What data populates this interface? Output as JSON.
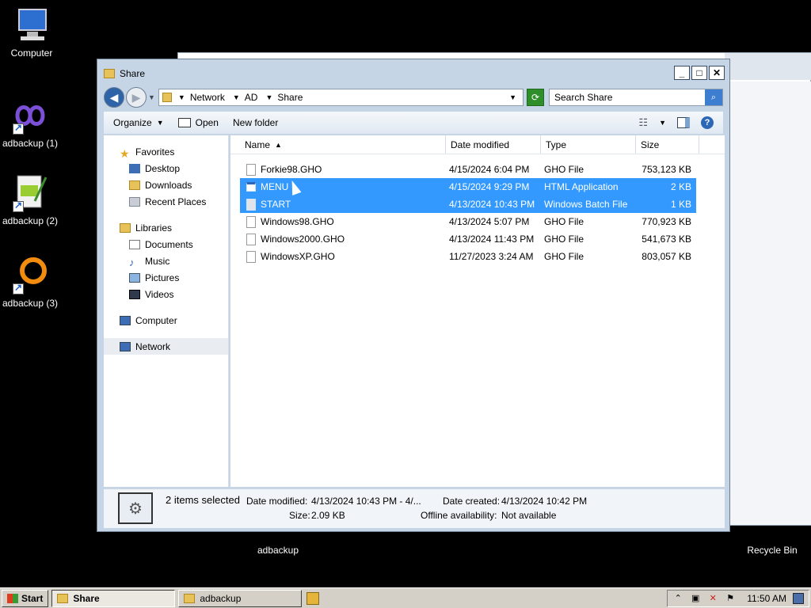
{
  "desktop": {
    "icons": [
      {
        "label": "Computer"
      },
      {
        "label": "adbackup (1)"
      },
      {
        "label": "adbackup (2)"
      },
      {
        "label": "adbackup (3)"
      },
      {
        "label": "adbackup"
      },
      {
        "label": "Recycle Bin"
      }
    ]
  },
  "window": {
    "title": "Share",
    "breadcrumb": [
      "Network",
      "AD",
      "Share"
    ],
    "search_placeholder": "Search Share",
    "toolbar": {
      "organize": "Organize",
      "open": "Open",
      "new_folder": "New folder"
    },
    "nav": {
      "favorites": "Favorites",
      "favorites_items": [
        "Desktop",
        "Downloads",
        "Recent Places"
      ],
      "libraries": "Libraries",
      "libraries_items": [
        "Documents",
        "Music",
        "Pictures",
        "Videos"
      ],
      "computer": "Computer",
      "network": "Network"
    },
    "columns": {
      "name": "Name",
      "date": "Date modified",
      "type": "Type",
      "size": "Size"
    },
    "files": [
      {
        "name": "Forkie98.GHO",
        "date": "4/15/2024 6:04 PM",
        "type": "GHO File",
        "size": "753,123 KB"
      },
      {
        "name": "MENU",
        "date": "4/15/2024 9:29 PM",
        "type": "HTML Application",
        "size": "2 KB"
      },
      {
        "name": "START",
        "date": "4/13/2024 10:43 PM",
        "type": "Windows Batch File",
        "size": "1 KB"
      },
      {
        "name": "Windows98.GHO",
        "date": "4/13/2024 5:07 PM",
        "type": "GHO File",
        "size": "770,923 KB"
      },
      {
        "name": "Windows2000.GHO",
        "date": "4/13/2024 11:43 PM",
        "type": "GHO File",
        "size": "541,673 KB"
      },
      {
        "name": "WindowsXP.GHO",
        "date": "11/27/2023 3:24 AM",
        "type": "GHO File",
        "size": "803,057 KB"
      }
    ],
    "details": {
      "selected": "2 items selected",
      "date_modified_label": "Date modified:",
      "date_modified_value": "4/13/2024 10:43 PM - 4/...",
      "date_created_label": "Date created:",
      "date_created_value": "4/13/2024 10:42 PM",
      "size_label": "Size:",
      "size_value": "2.09 KB",
      "offline_label": "Offline availability:",
      "offline_value": "Not available"
    }
  },
  "taskbar": {
    "start": "Start",
    "tasks": [
      "Share",
      "adbackup"
    ],
    "clock": "11:50 AM"
  }
}
